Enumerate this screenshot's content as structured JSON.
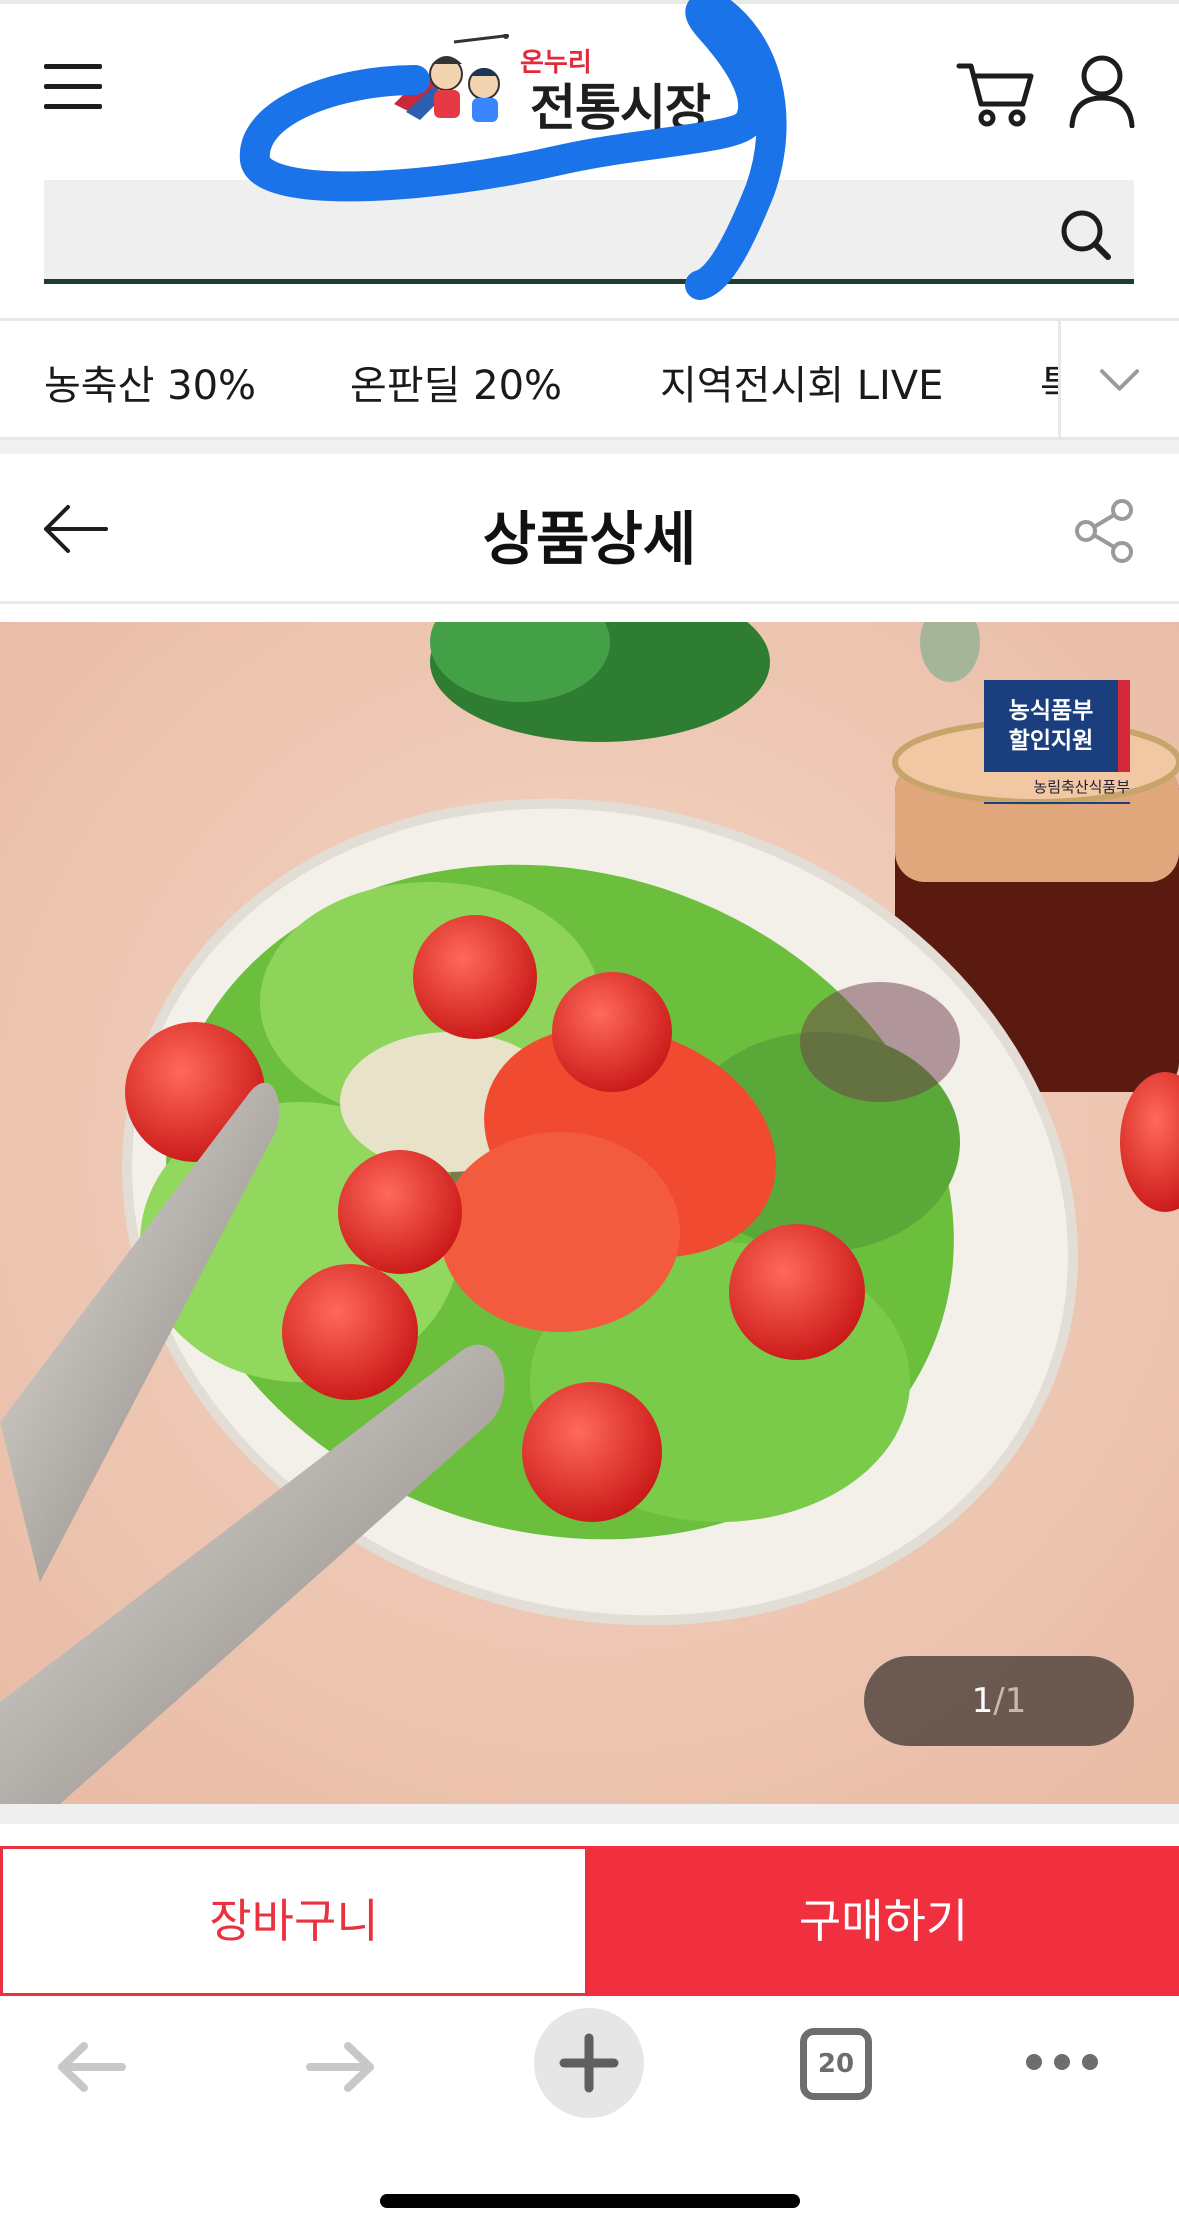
{
  "header": {
    "logo_small": "온누리",
    "logo_main": "전통시장",
    "search": {
      "placeholder": "",
      "value": ""
    }
  },
  "categories": [
    {
      "label": "농축산 30%"
    },
    {
      "label": "온판딜 20%"
    },
    {
      "label": "지역전시회 LIVE"
    }
  ],
  "category_overflow": "특",
  "title_bar": {
    "title": "상품상세"
  },
  "product": {
    "badge": {
      "line1": "농식품부",
      "line2": "할인지원",
      "org": "농림축산식품부"
    },
    "image_counter": {
      "current": "1",
      "separator": "/",
      "total": "1"
    }
  },
  "actions": {
    "cart_label": "장바구니",
    "buy_label": "구매하기"
  },
  "browser": {
    "tab_count": "20"
  },
  "colors": {
    "accent_red": "#f0303f",
    "search_underline": "#1f3d2c",
    "annotation_blue": "#1a73e8",
    "badge_blue": "#1b3f7e"
  },
  "icons": [
    "menu-icon",
    "cart-icon",
    "user-icon",
    "search-icon",
    "chevron-down-icon",
    "arrow-left-icon",
    "share-icon",
    "browser-back-icon",
    "browser-forward-icon",
    "plus-icon",
    "tabs-icon",
    "more-icon"
  ]
}
